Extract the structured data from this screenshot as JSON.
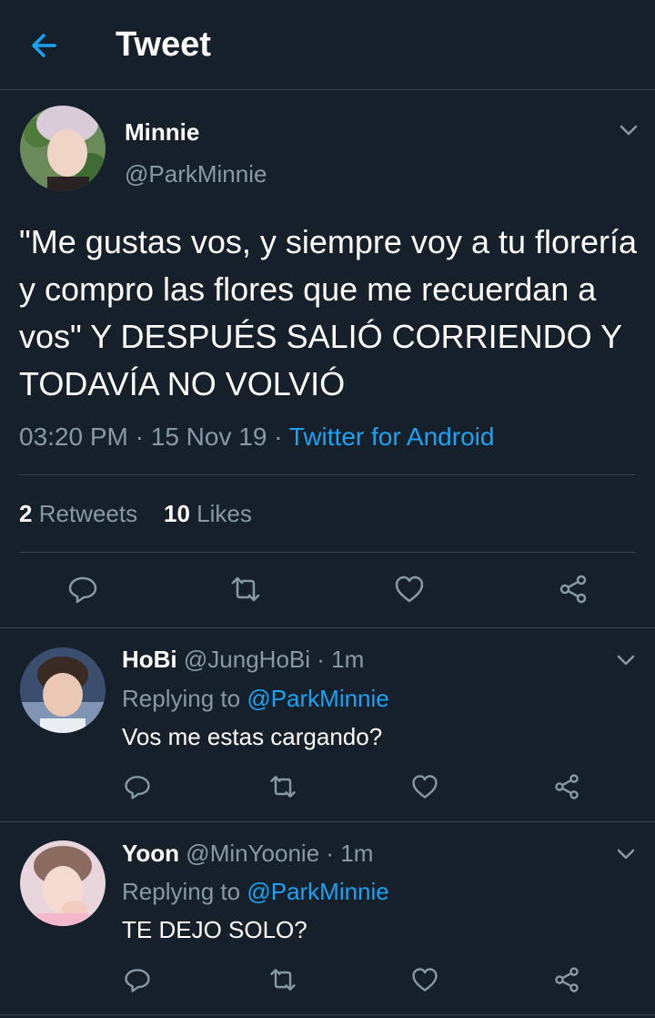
{
  "header": {
    "title": "Tweet",
    "back_icon": "back-arrow-icon"
  },
  "tweet": {
    "name": "Minnie",
    "handle": "@ParkMinnie",
    "text": "\"Me gustas vos, y siempre voy a tu florería y compro las flores que me recuerdan a vos\" Y DESPUÉS SALIÓ CORRIENDO Y TODAVÍA NO VOLVIÓ",
    "time": "03:20 PM",
    "sep1": "·",
    "date": "15 Nov 19",
    "sep2": "·",
    "source": "Twitter for Android",
    "retweets_count": "2",
    "retweets_label": "Retweets",
    "likes_count": "10",
    "likes_label": "Likes"
  },
  "replies": [
    {
      "name": "HoBi",
      "handle": "@JungHoBi",
      "time": "· 1m",
      "replying_label": "Replying to",
      "replying_handle": "@ParkMinnie",
      "text": "Vos me estas cargando?"
    },
    {
      "name": "Yoon",
      "handle": "@MinYoonie",
      "time": "· 1m",
      "replying_label": "Replying to",
      "replying_handle": "@ParkMinnie",
      "text": "TE DEJO SOLO?"
    }
  ],
  "colors": {
    "background": "#15202b",
    "accent": "#1da1f2",
    "muted": "#8899a6",
    "divider": "#38444d"
  }
}
